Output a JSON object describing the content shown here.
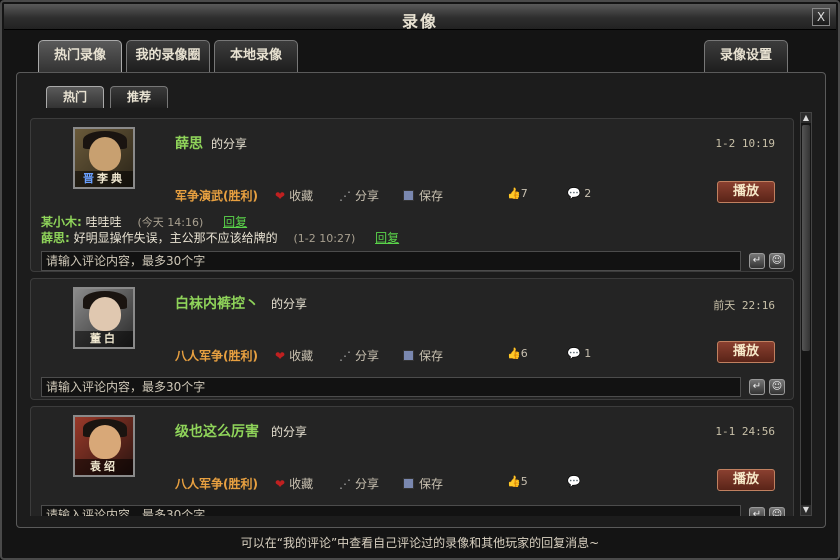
{
  "window": {
    "title": "录像",
    "close_label": "X"
  },
  "tabs": [
    {
      "label": "热门录像"
    },
    {
      "label": "我的录像圈"
    },
    {
      "label": "本地录像"
    }
  ],
  "settings_tab": "录像设置",
  "subtabs": [
    {
      "label": "热门"
    },
    {
      "label": "推荐"
    }
  ],
  "share_suffix": "的分享",
  "actions": {
    "favorite": "收藏",
    "share": "分享",
    "save": "保存"
  },
  "play_label": "播放",
  "comment_placeholder": "请输入评论内容，最多30个字",
  "cards": [
    {
      "user": "薛思",
      "time": "1-2 10:19",
      "avatar_name": "李典",
      "avatar_badge": "晋",
      "mode": "军争演武(胜利)",
      "likes": "7",
      "comments": "2",
      "replies": [
        {
          "user": "某小木:",
          "text": "哇哇哇",
          "time": "(今天 14:16)",
          "link": "回复"
        },
        {
          "user": "薛思:",
          "text": "好明显操作失误，主公那不应该给牌的",
          "time": "(1-2 10:27)",
          "link": "回复"
        }
      ]
    },
    {
      "user": "白袜内裤控丶",
      "time": "前天 22:16",
      "avatar_name": "董白",
      "mode": "八人军争(胜利)",
      "likes": "6",
      "comments": "1"
    },
    {
      "user": "级也这么厉害",
      "time": "1-1 24:56",
      "avatar_name": "袁绍",
      "mode": "八人军争(胜利)",
      "likes": "5",
      "comments": ""
    }
  ],
  "footer": "可以在“我的评论”中查看自己评论过的录像和其他玩家的回复消息~",
  "colors": {
    "username": "#8fd45a",
    "mode": "#e8a040",
    "play_button": "#7a3424"
  }
}
